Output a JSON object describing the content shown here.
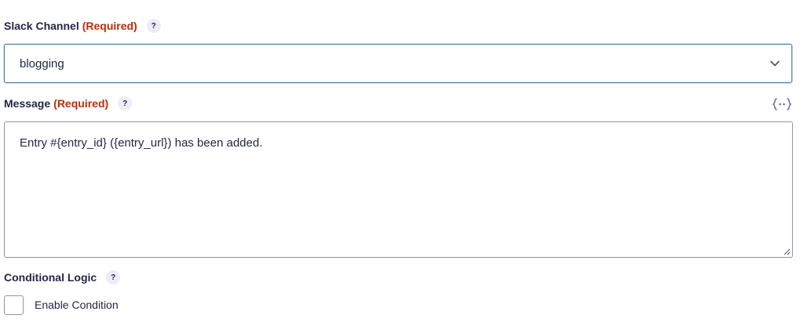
{
  "slack_channel": {
    "label": "Slack Channel",
    "required": "(Required)",
    "help": "?",
    "selected_value": "blogging"
  },
  "message": {
    "label": "Message",
    "required": "(Required)",
    "help": "?",
    "merge_tag_icon": "merge-tags-icon",
    "value": "Entry #{entry_id} ({entry_url}) has been added."
  },
  "conditional_logic": {
    "label": "Conditional Logic",
    "help": "?",
    "checkbox_label": "Enable Condition",
    "checked": false
  },
  "colors": {
    "required": "#c02b0a",
    "focus_border": "#3e7da6",
    "text": "#242748"
  }
}
